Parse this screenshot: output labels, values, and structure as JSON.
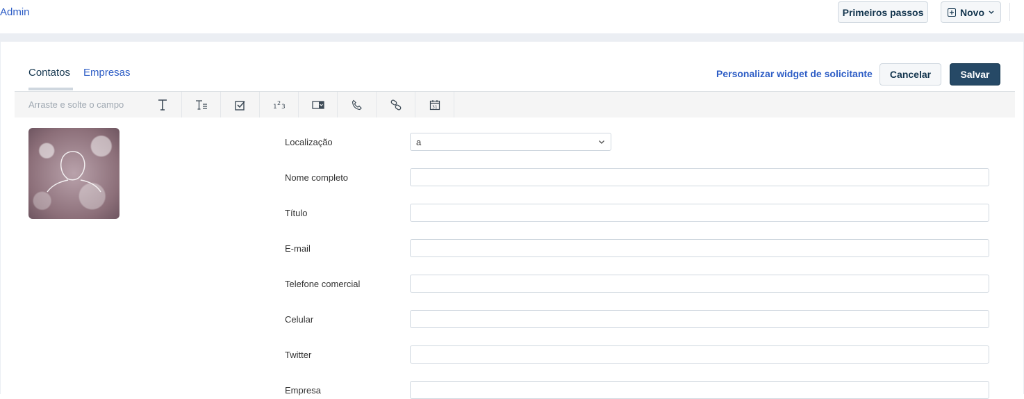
{
  "topbar": {
    "admin_label": "Admin",
    "primeiros_passos_label": "Primeiros passos",
    "novo_label": "Novo"
  },
  "tabs": [
    {
      "label": "Contatos",
      "active": true
    },
    {
      "label": "Empresas",
      "active": false
    }
  ],
  "actions": {
    "personalizar_label": "Personalizar widget de solicitante",
    "cancelar_label": "Cancelar",
    "salvar_label": "Salvar"
  },
  "toolbar": {
    "hint": "Arraste e solte o campo",
    "tools": [
      "text-icon",
      "paragraph-icon",
      "checkbox-icon",
      "number-icon",
      "dropdown-icon",
      "phone-icon",
      "link-icon",
      "calendar-icon"
    ]
  },
  "form": {
    "localizacao_label": "Localização",
    "localizacao_value": "a",
    "nome_completo_label": "Nome completo",
    "titulo_label": "Título",
    "email_label": "E-mail",
    "telefone_label": "Telefone comercial",
    "celular_label": "Celular",
    "twitter_label": "Twitter",
    "empresa_label": "Empresa"
  },
  "colors": {
    "accent": "#2c5cc5",
    "primary_button": "#264966"
  }
}
